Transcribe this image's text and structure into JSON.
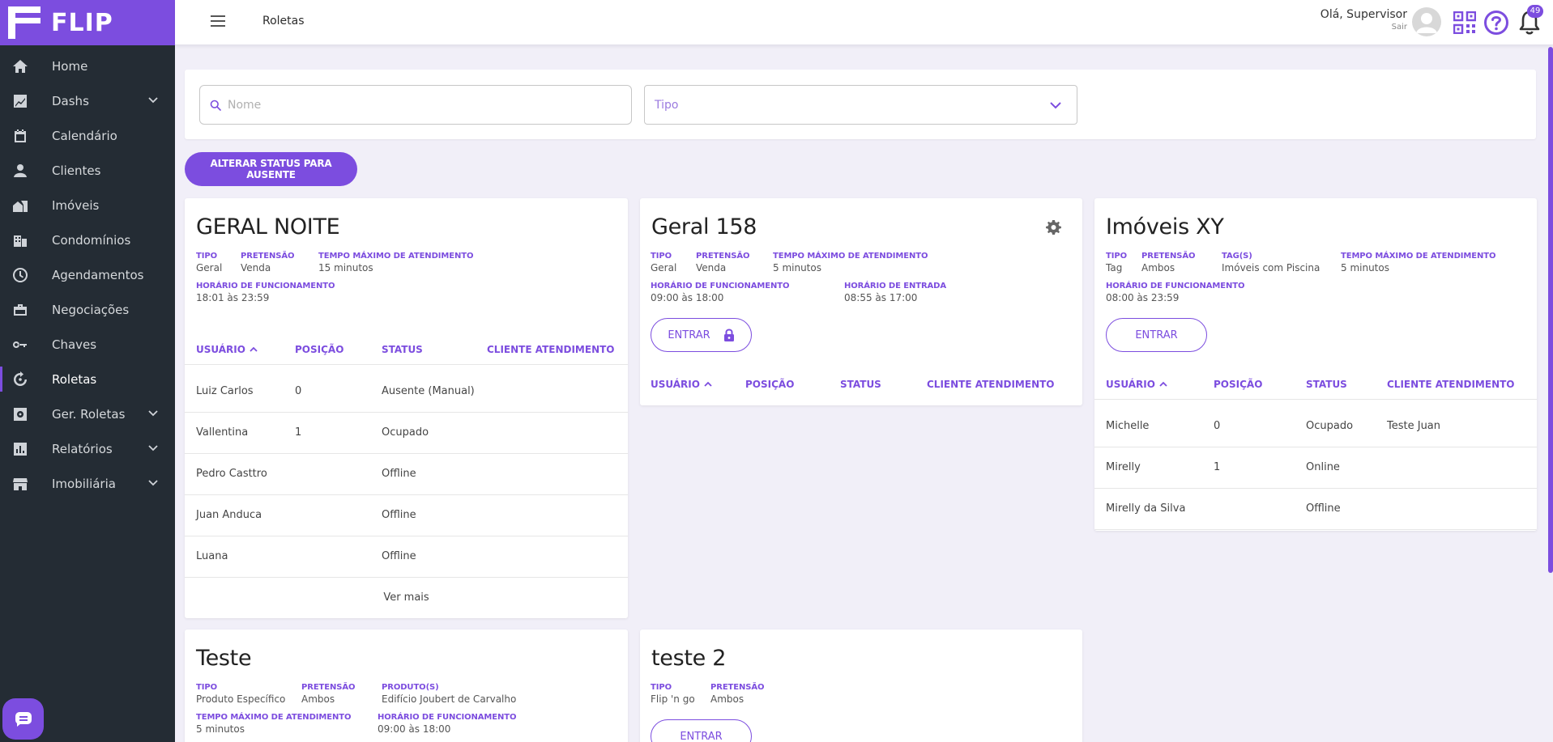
{
  "brand": {
    "name": "FLIP"
  },
  "sidebar": {
    "items": [
      {
        "label": "Home",
        "icon": "home-icon",
        "chevron": false,
        "active": false
      },
      {
        "label": "Dashs",
        "icon": "chart-icon",
        "chevron": true,
        "active": false
      },
      {
        "label": "Calendário",
        "icon": "calendar-icon",
        "chevron": false,
        "active": false
      },
      {
        "label": "Clientes",
        "icon": "person-icon",
        "chevron": false,
        "active": false
      },
      {
        "label": "Imóveis",
        "icon": "house-icon",
        "chevron": false,
        "active": false
      },
      {
        "label": "Condomínios",
        "icon": "building-icon",
        "chevron": false,
        "active": false
      },
      {
        "label": "Agendamentos",
        "icon": "clock-icon",
        "chevron": false,
        "active": false
      },
      {
        "label": "Negociações",
        "icon": "briefcase-icon",
        "chevron": false,
        "active": false
      },
      {
        "label": "Chaves",
        "icon": "key-icon",
        "chevron": false,
        "active": false
      },
      {
        "label": "Roletas",
        "icon": "roulette-icon",
        "chevron": false,
        "active": true
      },
      {
        "label": "Ger. Roletas",
        "icon": "settings-box-icon",
        "chevron": true,
        "active": false
      },
      {
        "label": "Relatórios",
        "icon": "report-icon",
        "chevron": true,
        "active": false
      },
      {
        "label": "Imobiliária",
        "icon": "store-icon",
        "chevron": true,
        "active": false
      }
    ]
  },
  "header": {
    "page_title": "Roletas",
    "greeting": "Olá, Supervisor",
    "logout": "Sair",
    "notifications": "49"
  },
  "filters": {
    "name_placeholder": "Nome",
    "type_placeholder": "Tipo"
  },
  "actions": {
    "status_button": "ALTERAR STATUS PARA AUSENTE"
  },
  "labels": {
    "tipo": "TIPO",
    "pretensao": "PRETENSÃO",
    "tempo": "TEMPO MÁXIMO DE ATENDIMENTO",
    "horario": "HORÁRIO DE FUNCIONAMENTO",
    "horario_entrada": "HORÁRIO DE ENTRADA",
    "tags": "TAG(S)",
    "produtos": "PRODUTO(S)",
    "enter": "ENTRAR",
    "see_more": "Ver mais",
    "col_user": "USUÁRIO",
    "col_pos": "POSIÇÃO",
    "col_status": "STATUS",
    "col_client": "CLIENTE ATENDIMENTO"
  },
  "cards": {
    "geral_noite": {
      "title": "GERAL NOITE",
      "tipo": "Geral",
      "pretensao": "Venda",
      "tempo": "15 minutos",
      "horario": "18:01 às 23:59",
      "rows": [
        {
          "user": "Luiz Carlos",
          "pos": "0",
          "status": "Ausente (Manual)",
          "client": ""
        },
        {
          "user": "Vallentina",
          "pos": "1",
          "status": "Ocupado",
          "client": ""
        },
        {
          "user": "Pedro Casttro",
          "pos": "",
          "status": "Offline",
          "client": ""
        },
        {
          "user": "Juan Anduca",
          "pos": "",
          "status": "Offline",
          "client": ""
        },
        {
          "user": "Luana",
          "pos": "",
          "status": "Offline",
          "client": ""
        }
      ]
    },
    "geral_158": {
      "title": "Geral 158",
      "tipo": "Geral",
      "pretensao": "Venda",
      "tempo": "5 minutos",
      "horario": "09:00 às 18:00",
      "horario_entrada": "08:55 às 17:00"
    },
    "imoveis_xy": {
      "title": "Imóveis XY",
      "tipo": "Tag",
      "pretensao": "Ambos",
      "tags": "Imóveis com Piscina",
      "tempo": "5 minutos",
      "horario": "08:00 às 23:59",
      "rows": [
        {
          "user": "Michelle",
          "pos": "0",
          "status": "Ocupado",
          "client": "Teste Juan"
        },
        {
          "user": "Mirelly",
          "pos": "1",
          "status": "Online",
          "client": ""
        },
        {
          "user": "Mirelly da Silva",
          "pos": "",
          "status": "Offline",
          "client": ""
        }
      ]
    },
    "teste": {
      "title": "Teste",
      "tipo": "Produto Específico",
      "pretensao": "Ambos",
      "produtos": "Edifício Joubert de Carvalho",
      "tempo": "5 minutos",
      "horario": "09:00 às 18:00"
    },
    "teste2": {
      "title": "teste 2",
      "tipo": "Flip 'n go",
      "pretensao": "Ambos"
    }
  },
  "colors": {
    "accent": "#7c4ddf",
    "sidebar": "#242c34",
    "background": "#f1eff8"
  }
}
